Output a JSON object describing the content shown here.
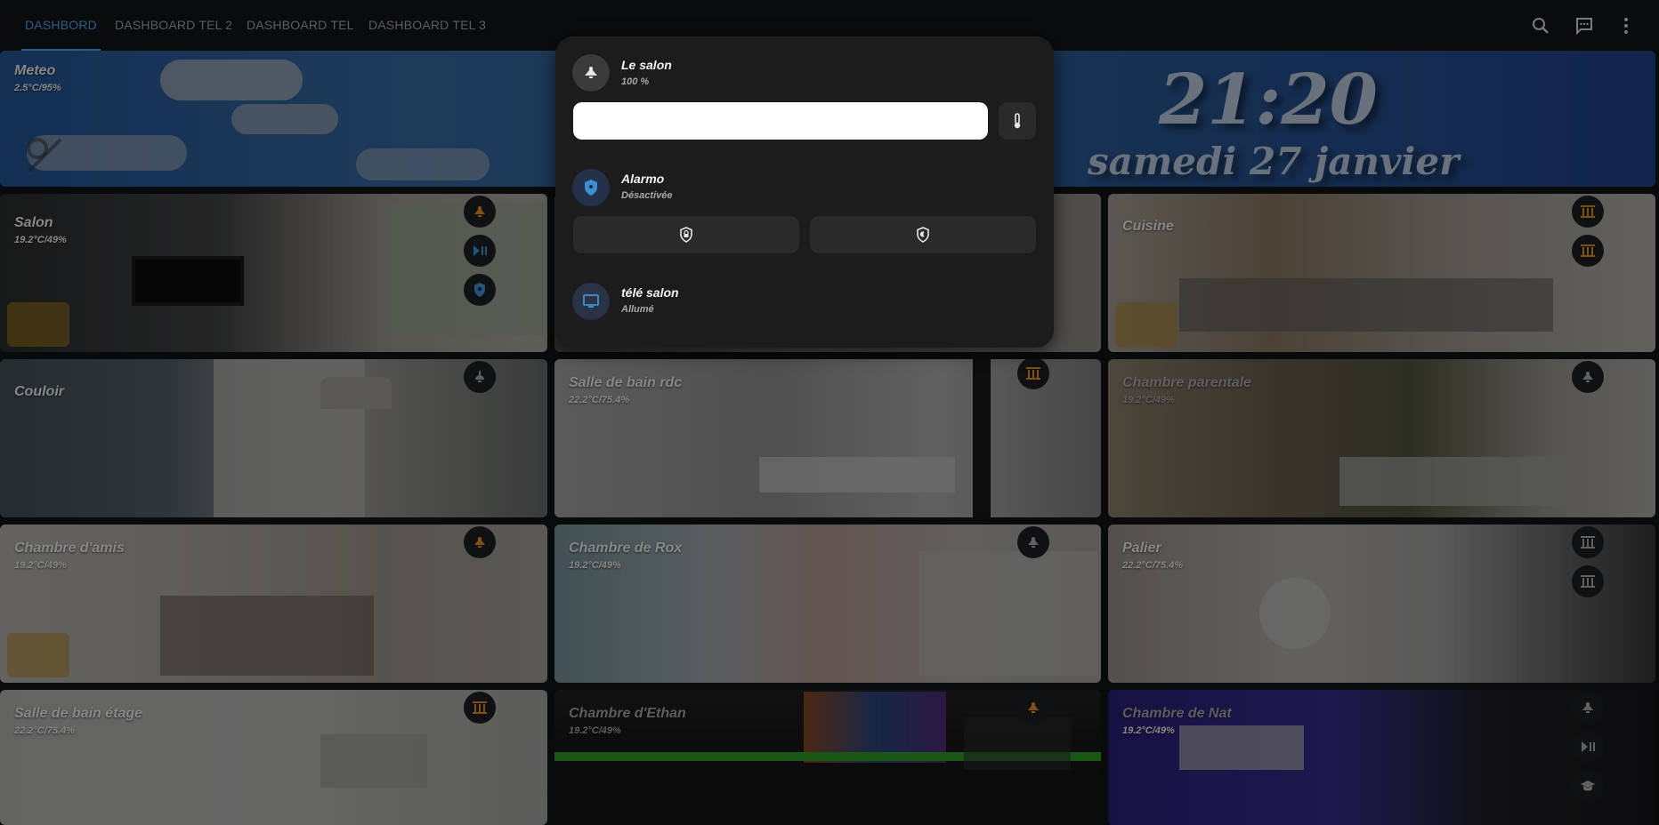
{
  "tabs": [
    "DASHBORD",
    "DASHBOARD TEL 2",
    "DASHBOARD TEL",
    "DASHBOARD TEL 3"
  ],
  "top_icons": [
    "search-icon",
    "chat-icon",
    "more-vert-icon"
  ],
  "meteo": {
    "title": "Meteo",
    "sub": "2.5°C/95%"
  },
  "clock": {
    "time": "21:20",
    "date": "samedi 27 janvier"
  },
  "rooms": [
    {
      "title": "Salon",
      "sub": "19.2°C/49%"
    },
    {
      "title": "Cuisine",
      "sub": ""
    },
    {
      "title": "Couloir",
      "sub": ""
    },
    {
      "title": "Salle de bain rdc",
      "sub": "22.2°C/75.4%"
    },
    {
      "title": "Chambre parentale",
      "sub": "19.2°C/49%"
    },
    {
      "title": "Chambre d'amis",
      "sub": "19.2°C/49%"
    },
    {
      "title": "Chambre de Rox",
      "sub": "19.2°C/49%"
    },
    {
      "title": "Palier",
      "sub": "22.2°C/75.4%"
    },
    {
      "title": "Salle de bain étage",
      "sub": "22.2°C/75.4%"
    },
    {
      "title": "Chambre d'Ethan",
      "sub": "19.2°C/49%"
    },
    {
      "title": "Chambre de Nat",
      "sub": "19.2°C/49%"
    }
  ],
  "popup": {
    "light": {
      "name": "Le salon",
      "state": "100 %",
      "brightness": 1.0
    },
    "alarm": {
      "name": "Alarmo",
      "state": "Désactivée"
    },
    "tv": {
      "name": "télé salon",
      "state": "Allumé"
    }
  },
  "colors": {
    "accent": "#4aa0e6",
    "active_icon": "#e08a1e",
    "alarm_blue": "#3d8fd6"
  }
}
